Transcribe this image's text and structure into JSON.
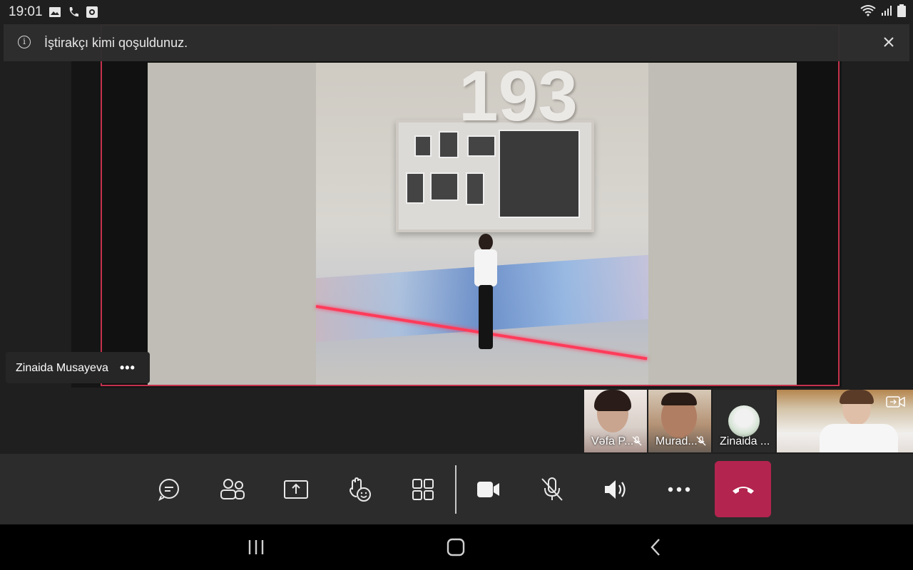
{
  "status_bar": {
    "time": "19:01",
    "left_icons": [
      "image-icon",
      "phone-icon",
      "screen-record-icon"
    ],
    "right_icons": [
      "wifi-icon",
      "signal-icon",
      "battery-icon"
    ]
  },
  "notification": {
    "text": "İştirakçı kimi qoşuldunuz.",
    "icon": "info-icon"
  },
  "stage": {
    "presenter_name": "Zinaida Musayeva",
    "more_label": "•••",
    "photo_number_text": "193"
  },
  "participants": [
    {
      "label": "Vəfa P...",
      "muted": true
    },
    {
      "label": "Murad...",
      "muted": true
    },
    {
      "label": "Zinaida ...",
      "muted": false
    },
    {
      "label": "",
      "muted": false
    }
  ],
  "controls": {
    "items": [
      "chat-icon",
      "people-icon",
      "share-icon",
      "raise-hand-icon",
      "layout-icon",
      "camera-icon",
      "mic-off-icon",
      "speaker-icon",
      "more-icon",
      "hangup-icon"
    ]
  },
  "colors": {
    "accent_border": "#c4314b",
    "hangup": "#b3244f",
    "control_bar": "#2c2c2c"
  }
}
